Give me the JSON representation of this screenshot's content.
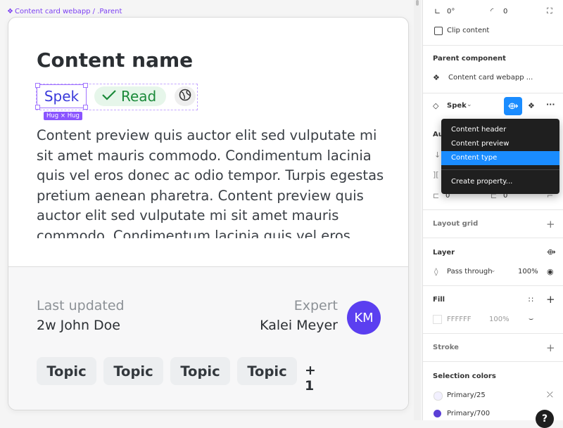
{
  "breadcrumb": {
    "icon": "component-icon",
    "text": "Content card webapp / .Parent"
  },
  "card": {
    "title": "Content name",
    "chips": {
      "type_label": "Spek",
      "hug_badge": "Hug × Hug",
      "read_label": "Read",
      "globe_icon": "globe-icon",
      "check_icon": "check-icon"
    },
    "preview": "Content preview quis auctor elit sed vulputate mi sit amet mauris commodo. Condimentum lacinia quis vel eros donec ac odio tempor. Turpis egestas pretium aenean pharetra. Content preview quis auctor elit sed vulputate mi sit amet mauris commodo. Condimentum lacinia quis vel eros",
    "footer": {
      "last_updated_label": "Last updated",
      "last_updated_value": "2w John Doe",
      "expert_label": "Expert",
      "expert_name": "Kalei Meyer",
      "avatar_initials": "KM",
      "topics": [
        "Topic",
        "Topic",
        "Topic",
        "Topic"
      ],
      "more_count": "+ 1"
    }
  },
  "panel": {
    "rotation": "0°",
    "radius": "0",
    "clip_content": "Clip content",
    "parent_component": {
      "title": "Parent component",
      "name": "Content card webapp ..."
    },
    "instance": {
      "name": "Spek",
      "chevron": "chevron-down-icon"
    },
    "dropdown": {
      "items": [
        "Content header",
        "Content preview",
        "Content type"
      ],
      "active": "Content type",
      "create": "Create property..."
    },
    "auto_layout": {
      "title_fragment": "Aut",
      "spacing_left": "0",
      "spacing_right": "0"
    },
    "layout_grid": {
      "title": "Layout grid"
    },
    "layer": {
      "title": "Layer",
      "blend": "Pass through",
      "opacity": "100%"
    },
    "fill": {
      "title": "Fill",
      "hex": "FFFFFF",
      "opacity": "100%"
    },
    "stroke": {
      "title": "Stroke"
    },
    "selection_colors": {
      "title": "Selection colors",
      "items": [
        {
          "name": "Primary/25",
          "color": "#f2f0ff"
        },
        {
          "name": "Primary/700",
          "color": "#5b3fd6"
        }
      ]
    },
    "help": "?"
  },
  "colors": {
    "accent": "#1a8cff",
    "purple": "#7b3ff2",
    "avatar": "#5b3ff0",
    "read_green": "#1b8a3a"
  }
}
